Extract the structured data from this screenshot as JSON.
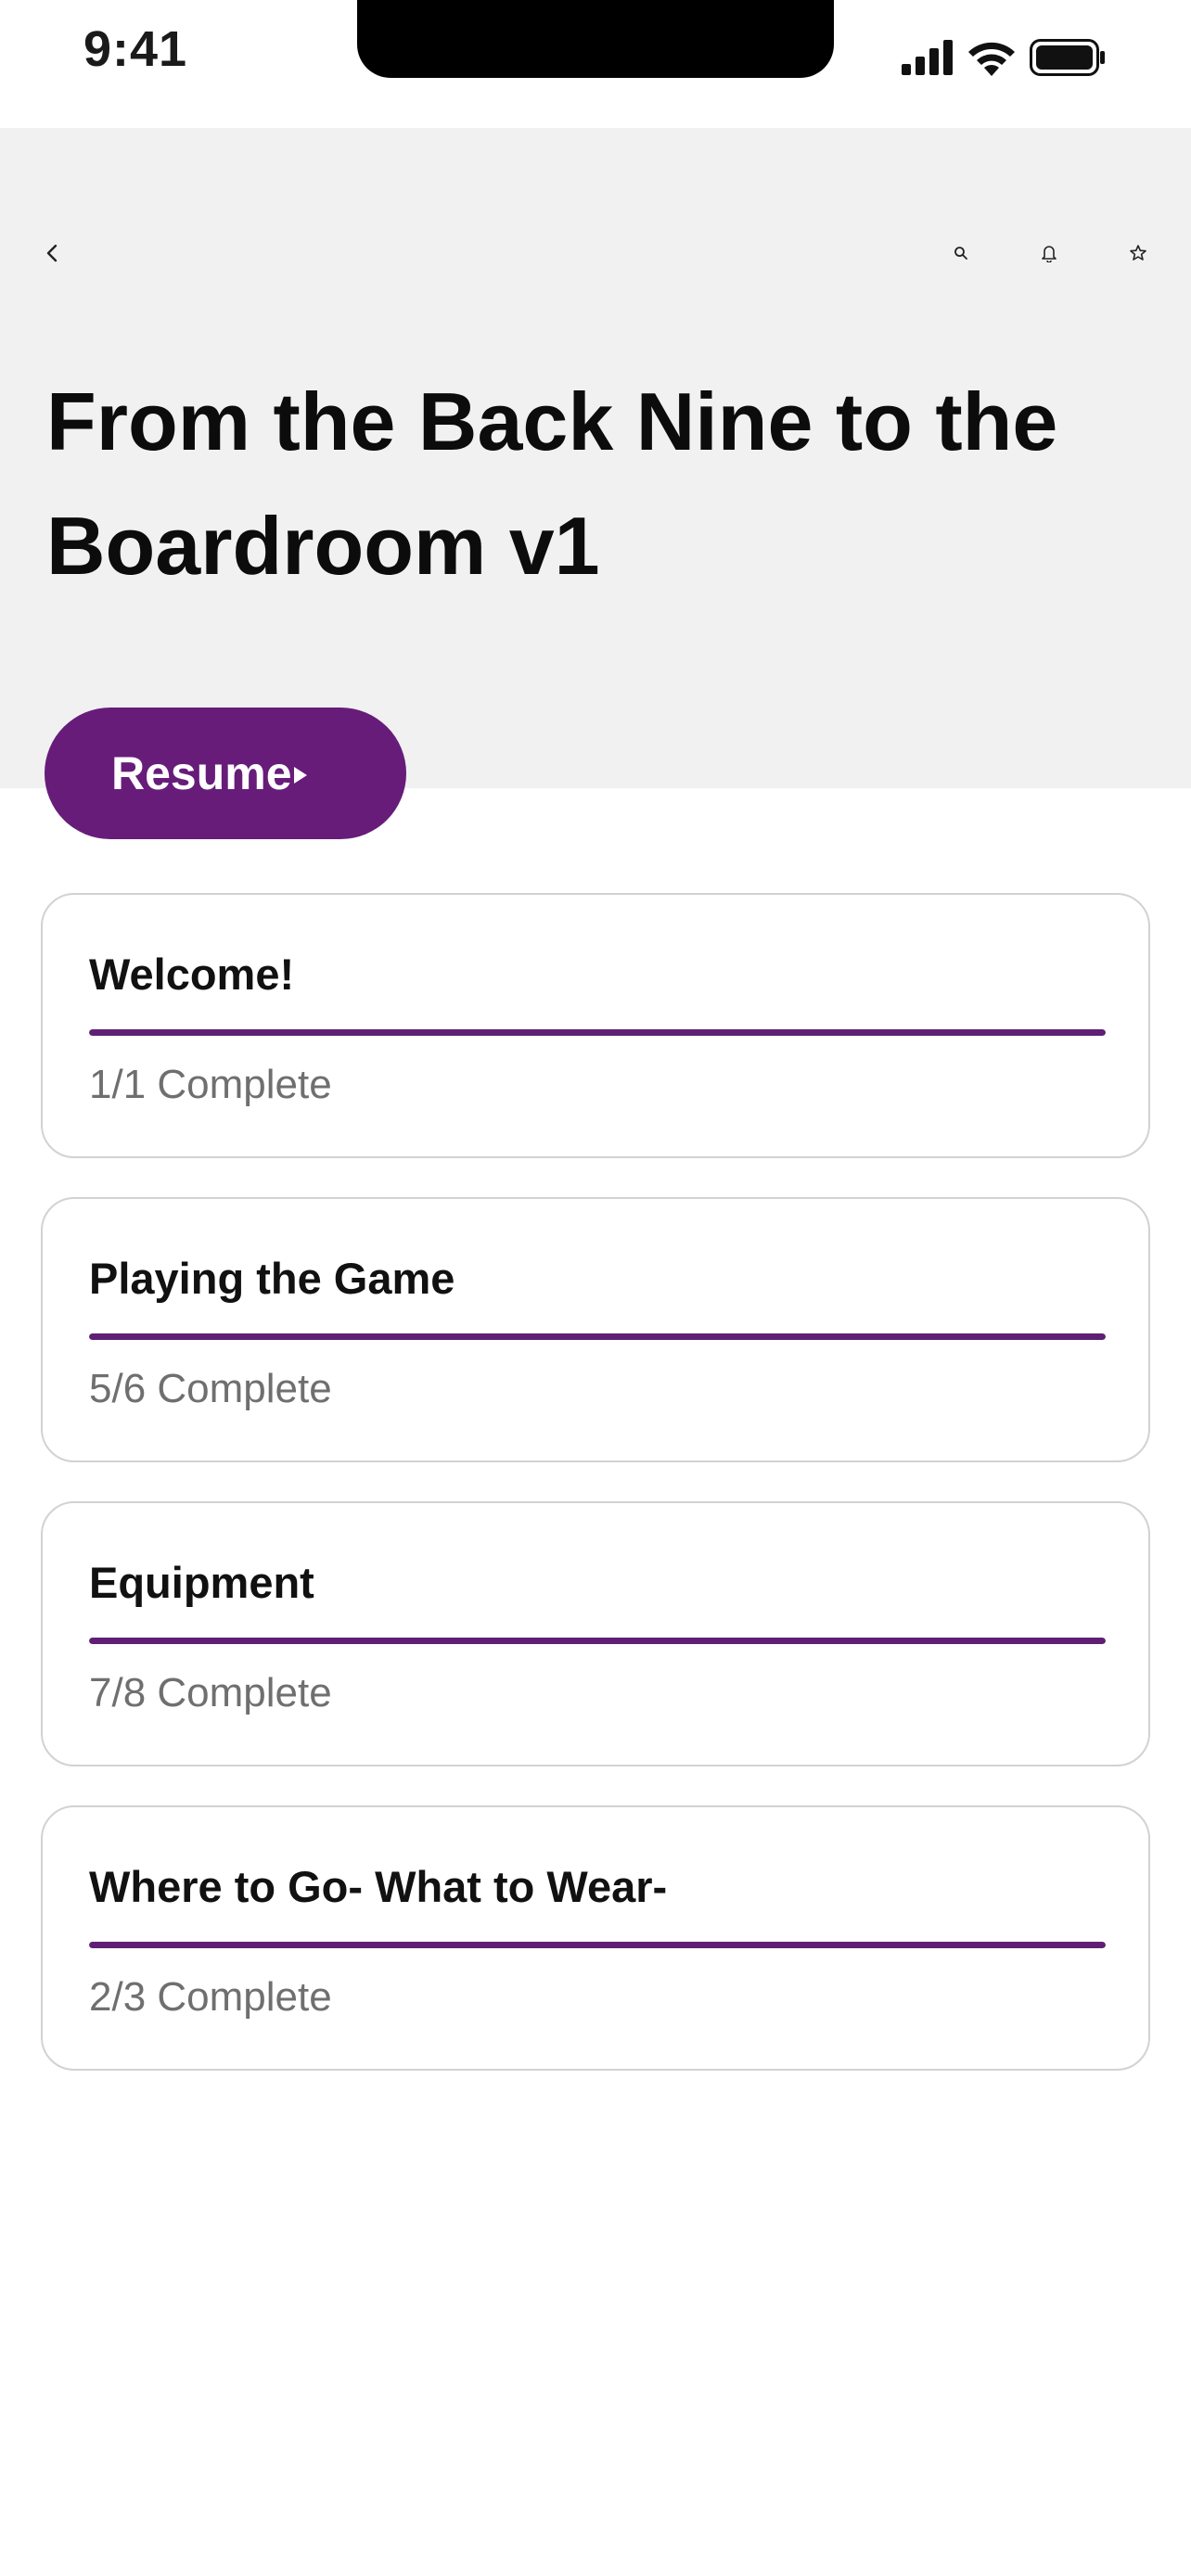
{
  "status_bar": {
    "time": "9:41",
    "icons": [
      "cellular-signal-icon",
      "wifi-icon",
      "battery-icon"
    ]
  },
  "header": {
    "title": "From the Back Nine to the Boardroom v1",
    "back_icon": "chevron-left-icon",
    "action_icons": [
      "search-icon",
      "bell-icon",
      "star-icon"
    ],
    "background_color": "#f1f1f1"
  },
  "resume_button": {
    "label": "Resume",
    "icon": "play-icon",
    "color": "#671c7a"
  },
  "modules": [
    {
      "title": "Welcome!",
      "status": "1/1 Complete",
      "progress": 1.0
    },
    {
      "title": "Playing the Game",
      "status": "5/6 Complete",
      "progress": 1.0
    },
    {
      "title": "Equipment",
      "status": "7/8 Complete",
      "progress": 1.0
    },
    {
      "title": "Where to Go- What to Wear-",
      "status": "2/3 Complete",
      "progress": 1.0
    }
  ],
  "colors": {
    "accent": "#5f1f75",
    "muted_text": "#6f6f6f",
    "card_border": "#d2d2d2"
  }
}
